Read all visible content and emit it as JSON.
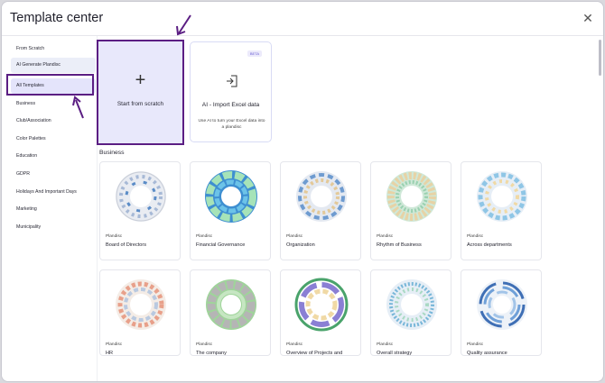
{
  "title": "Template center",
  "sidebar": {
    "items": [
      {
        "label": "From Scratch"
      },
      {
        "label": "AI Generate Plandisc"
      },
      {
        "label": "All Templates"
      },
      {
        "label": "Business"
      },
      {
        "label": "Club/Association"
      },
      {
        "label": "Color Palettes"
      },
      {
        "label": "Education"
      },
      {
        "label": "GDPR"
      },
      {
        "label": "Holidays And Important Days"
      },
      {
        "label": "Marketing"
      },
      {
        "label": "Municipality"
      }
    ]
  },
  "start_card": {
    "label": "Start from scratch"
  },
  "ai_card": {
    "badge": "BETA",
    "title": "AI - Import Excel data",
    "description": "Use AI to turn your Excel data into a plandisc"
  },
  "section": {
    "title": "Business"
  },
  "templates": [
    {
      "kind": "Plandisc",
      "name": "Board of Directors"
    },
    {
      "kind": "Plandisc",
      "name": "Financial Governance"
    },
    {
      "kind": "Plandisc",
      "name": "Organization"
    },
    {
      "kind": "Plandisc",
      "name": "Rhythm of Business"
    },
    {
      "kind": "Plandisc",
      "name": "Across departments"
    },
    {
      "kind": "Plandisc",
      "name": "HR"
    },
    {
      "kind": "Plandisc",
      "name": "The company"
    },
    {
      "kind": "Plandisc",
      "name": "Overview of Projects and"
    },
    {
      "kind": "Plandisc",
      "name": "Overall strategy"
    },
    {
      "kind": "Plandisc",
      "name": "Quality assurance"
    }
  ],
  "colors": {
    "accent": "#5b1e83",
    "selected_bg": "#e4e4fb",
    "blue": "#5b8cc7",
    "green": "#7ec9a0"
  }
}
